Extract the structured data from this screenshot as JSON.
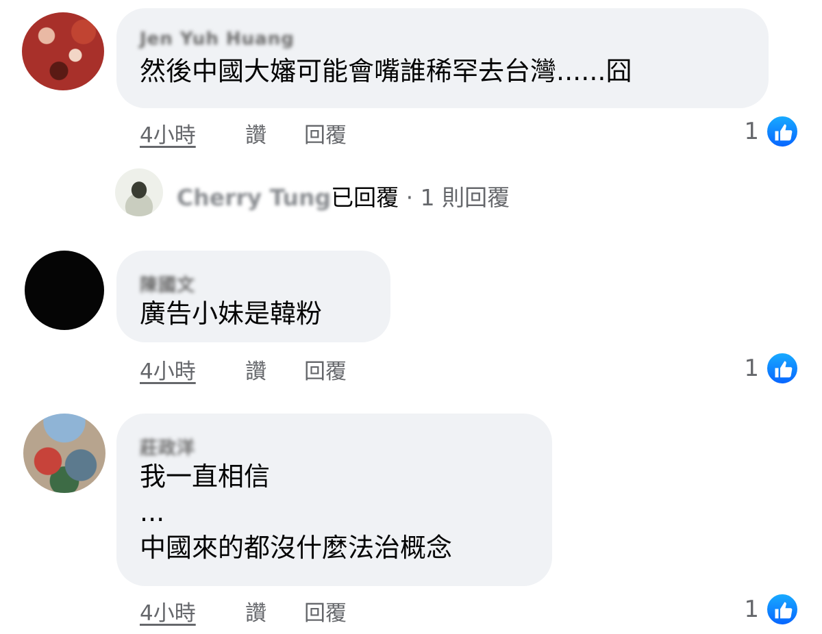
{
  "comments": [
    {
      "author": "Jen Yuh Huang",
      "lines": [
        "然後中國大嬸可能會嘴誰稀罕去台灣......囧"
      ],
      "time": "4小時",
      "like": "讚",
      "reply": "回覆",
      "reaction_count": "1"
    },
    {
      "author": "陳國文",
      "lines": [
        "廣告小妹是韓粉"
      ],
      "time": "4小時",
      "like": "讚",
      "reply": "回覆",
      "reaction_count": "1"
    },
    {
      "author": "莊政洋",
      "lines": [
        "我一直相信",
        "...",
        "中國來的都沒什麼法治概念"
      ],
      "time": "4小時",
      "like": "讚",
      "reply": "回覆",
      "reaction_count": "1"
    }
  ],
  "reply_summary": {
    "replier": "Cherry Tung",
    "replied_text": "已回覆",
    "separator": " · ",
    "count_text": "1 則回覆"
  },
  "colors": {
    "bubble": "#f0f2f5",
    "meta_text": "#65676b",
    "like_badge": "#0866ff"
  },
  "icons": [
    "thumbs-up-icon"
  ]
}
